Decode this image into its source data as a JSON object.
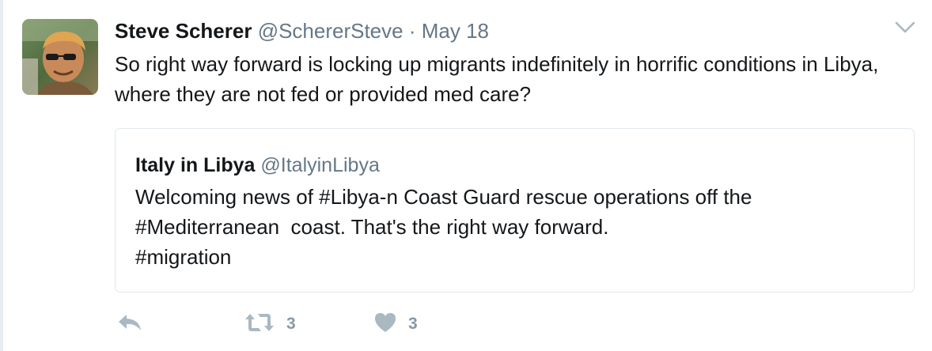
{
  "tweet": {
    "author_name": "Steve Scherer",
    "author_handle": "@SchererSteve",
    "separator": "·",
    "date": "May 18",
    "text": "So right way forward is locking up migrants indefinitely in horrific conditions in Libya, where they are not fed or provided med care?"
  },
  "quoted_tweet": {
    "author_name": "Italy in Libya",
    "author_handle": "@ItalyinLibya",
    "lines": [
      "Welcoming news of #Libya-n Coast Guard rescue operations off the",
      "#Mediterranean  coast. That's the right way forward.",
      "#migration"
    ]
  },
  "actions": {
    "reply_icon": "reply-icon",
    "retweet_icon": "retweet-icon",
    "retweet_count": "3",
    "like_icon": "heart-icon",
    "like_count": "3"
  },
  "colors": {
    "text": "#14171a",
    "secondary": "#657786",
    "action_icon": "#aab8c2",
    "border": "#e1e8ed"
  }
}
